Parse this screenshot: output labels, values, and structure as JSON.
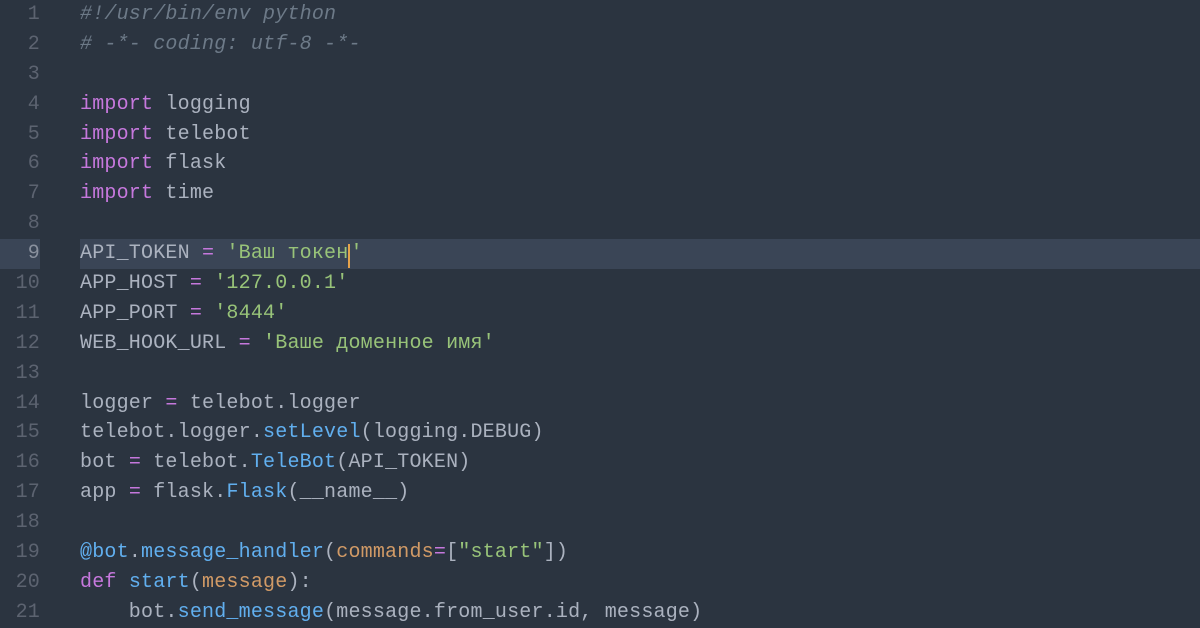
{
  "editor": {
    "highlighted_line": 9,
    "cursor": {
      "line": 9,
      "after_token_index": 6
    },
    "lines": [
      {
        "n": 1,
        "tokens": [
          {
            "cls": "cmt",
            "t": "#!/usr/bin/env python"
          }
        ]
      },
      {
        "n": 2,
        "tokens": [
          {
            "cls": "cmt",
            "t": "# -*- coding: utf-8 -*-"
          }
        ]
      },
      {
        "n": 3,
        "tokens": []
      },
      {
        "n": 4,
        "tokens": [
          {
            "cls": "kw",
            "t": "import"
          },
          {
            "cls": "nm",
            "t": " logging"
          }
        ]
      },
      {
        "n": 5,
        "tokens": [
          {
            "cls": "kw",
            "t": "import"
          },
          {
            "cls": "nm",
            "t": " telebot"
          }
        ]
      },
      {
        "n": 6,
        "tokens": [
          {
            "cls": "kw",
            "t": "import"
          },
          {
            "cls": "nm",
            "t": " flask"
          }
        ]
      },
      {
        "n": 7,
        "tokens": [
          {
            "cls": "kw",
            "t": "import"
          },
          {
            "cls": "nm",
            "t": " time"
          }
        ]
      },
      {
        "n": 8,
        "tokens": []
      },
      {
        "n": 9,
        "tokens": [
          {
            "cls": "nm",
            "t": "API_TOKEN "
          },
          {
            "cls": "op",
            "t": "="
          },
          {
            "cls": "nm",
            "t": " "
          },
          {
            "cls": "str",
            "t": "'"
          },
          {
            "cls": "str",
            "t": "Ваш "
          },
          {
            "cls": "str",
            "t": "токен"
          },
          {
            "cls": "str",
            "t": "'"
          }
        ]
      },
      {
        "n": 10,
        "tokens": [
          {
            "cls": "nm",
            "t": "APP_HOST "
          },
          {
            "cls": "op",
            "t": "="
          },
          {
            "cls": "nm",
            "t": " "
          },
          {
            "cls": "str",
            "t": "'127.0.0.1'"
          }
        ]
      },
      {
        "n": 11,
        "tokens": [
          {
            "cls": "nm",
            "t": "APP_PORT "
          },
          {
            "cls": "op",
            "t": "="
          },
          {
            "cls": "nm",
            "t": " "
          },
          {
            "cls": "str",
            "t": "'8444'"
          }
        ]
      },
      {
        "n": 12,
        "tokens": [
          {
            "cls": "nm",
            "t": "WEB_HOOK_URL "
          },
          {
            "cls": "op",
            "t": "="
          },
          {
            "cls": "nm",
            "t": " "
          },
          {
            "cls": "str",
            "t": "'Ваше доменное имя'"
          }
        ]
      },
      {
        "n": 13,
        "tokens": []
      },
      {
        "n": 14,
        "tokens": [
          {
            "cls": "nm",
            "t": "logger "
          },
          {
            "cls": "op",
            "t": "="
          },
          {
            "cls": "nm",
            "t": " telebot.logger"
          }
        ]
      },
      {
        "n": 15,
        "tokens": [
          {
            "cls": "nm",
            "t": "telebot.logger."
          },
          {
            "cls": "fn",
            "t": "setLevel"
          },
          {
            "cls": "punc",
            "t": "(logging."
          },
          {
            "cls": "nm",
            "t": "DEBUG"
          },
          {
            "cls": "punc",
            "t": ")"
          }
        ]
      },
      {
        "n": 16,
        "tokens": [
          {
            "cls": "nm",
            "t": "bot "
          },
          {
            "cls": "op",
            "t": "="
          },
          {
            "cls": "nm",
            "t": " telebot."
          },
          {
            "cls": "fn",
            "t": "TeleBot"
          },
          {
            "cls": "punc",
            "t": "(API_TOKEN)"
          }
        ]
      },
      {
        "n": 17,
        "tokens": [
          {
            "cls": "nm",
            "t": "app "
          },
          {
            "cls": "op",
            "t": "="
          },
          {
            "cls": "nm",
            "t": " flask."
          },
          {
            "cls": "fn",
            "t": "Flask"
          },
          {
            "cls": "punc",
            "t": "(__name__)"
          }
        ]
      },
      {
        "n": 18,
        "tokens": []
      },
      {
        "n": 19,
        "tokens": [
          {
            "cls": "fn",
            "t": "@bot"
          },
          {
            "cls": "nm",
            "t": "."
          },
          {
            "cls": "fn",
            "t": "message_handler"
          },
          {
            "cls": "punc",
            "t": "("
          },
          {
            "cls": "arg",
            "t": "commands"
          },
          {
            "cls": "op",
            "t": "="
          },
          {
            "cls": "punc",
            "t": "["
          },
          {
            "cls": "str",
            "t": "\"start\""
          },
          {
            "cls": "punc",
            "t": "])"
          }
        ]
      },
      {
        "n": 20,
        "tokens": [
          {
            "cls": "kw",
            "t": "def"
          },
          {
            "cls": "nm",
            "t": " "
          },
          {
            "cls": "fn",
            "t": "start"
          },
          {
            "cls": "punc",
            "t": "("
          },
          {
            "cls": "arg",
            "t": "message"
          },
          {
            "cls": "punc",
            "t": "):"
          }
        ]
      },
      {
        "n": 21,
        "tokens": [
          {
            "cls": "nm",
            "t": "    bot."
          },
          {
            "cls": "fn",
            "t": "send_message"
          },
          {
            "cls": "punc",
            "t": "(message.from_user.id, message)"
          }
        ]
      }
    ]
  }
}
